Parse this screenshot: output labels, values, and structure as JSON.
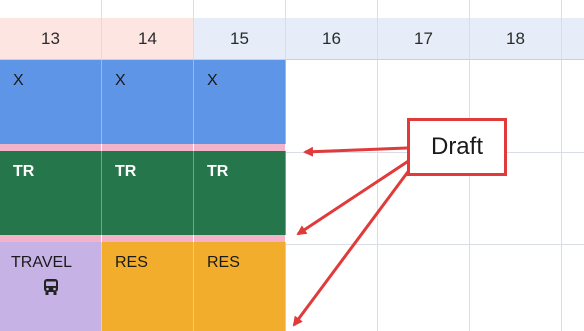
{
  "calendar": {
    "day_headers": [
      "13",
      "14",
      "15",
      "16",
      "17",
      "18"
    ],
    "rows": [
      [
        "X",
        "X",
        "X"
      ],
      [
        "TR",
        "TR",
        "TR"
      ],
      [
        "TRAVEL",
        "RES",
        "RES"
      ]
    ],
    "travel_icon": "bus-icon"
  },
  "annotation": {
    "callout_label": "Draft"
  },
  "colors": {
    "weekend_header": "#fde5e1",
    "weekday_header": "#e6edf8",
    "x_block": "#5e95e6",
    "tr_block": "#26764c",
    "res_block": "#f2ad2d",
    "travel_block": "#c7b2e6",
    "draft_strip": "#f3b3cb",
    "callout_red": "#e03a3a"
  }
}
